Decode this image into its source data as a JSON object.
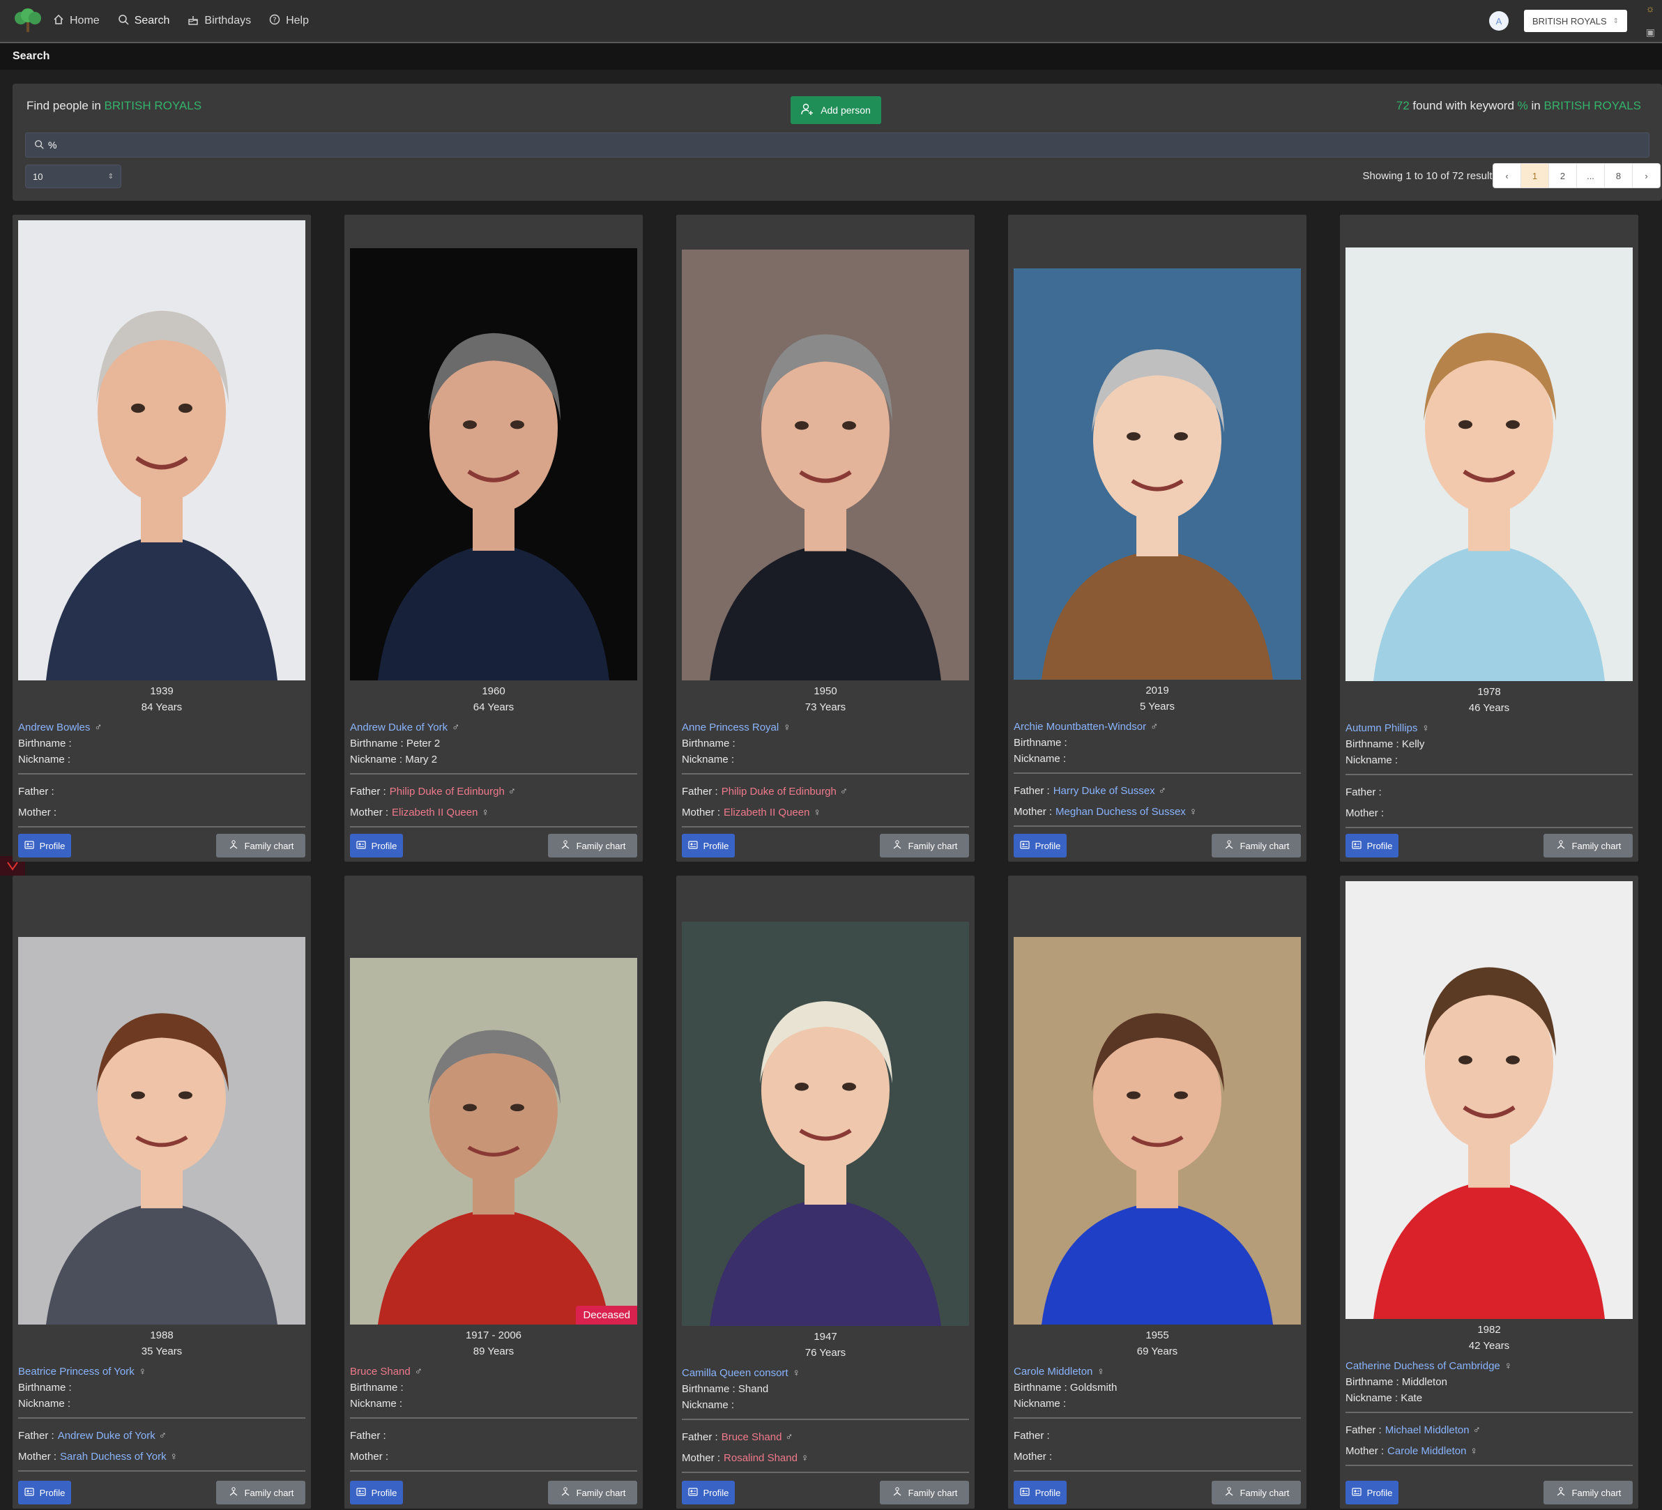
{
  "nav": {
    "items": [
      {
        "label": "Home",
        "icon": "home-icon"
      },
      {
        "label": "Search",
        "icon": "search-icon"
      },
      {
        "label": "Birthdays",
        "icon": "cake-icon"
      },
      {
        "label": "Help",
        "icon": "help-icon"
      }
    ],
    "avatar_initial": "A",
    "database_select": "BRITISH ROYALS"
  },
  "subheader": {
    "title": "Search"
  },
  "search_panel": {
    "find_prefix": "Find people in",
    "database_name": "BRITISH ROYALS",
    "add_person_label": "Add person",
    "found_count": "72",
    "found_text": "found with keyword",
    "keyword": "%",
    "found_in": "in",
    "found_db": "BRITISH ROYALS",
    "search_value": "%",
    "page_size": "10",
    "showing_text": "Showing 1 to 10 of 72 results",
    "pagination": [
      "1",
      "2",
      "...",
      "8"
    ]
  },
  "labels": {
    "birthname": "Birthname :",
    "nickname": "Nickname :",
    "father": "Father :",
    "mother": "Mother :",
    "profile": "Profile",
    "family_chart": "Family chart",
    "deceased": "Deceased"
  },
  "colors": {
    "accent_green": "#35b36b",
    "link_blue": "#8ab4ff",
    "link_red": "#f07a8c",
    "profile_button": "#3a63c6",
    "family_chart_button": "#6f737a",
    "deceased_badge": "#d9224d"
  },
  "people": [
    {
      "year": "1939",
      "age": "84 Years",
      "name": "Andrew Bowles",
      "name_color": "blue",
      "gender": "♂",
      "birthname": "",
      "nickname": "",
      "father": "",
      "father_color": "",
      "father_gender": "",
      "mother": "",
      "mother_color": "",
      "mother_gender": "",
      "deceased": false
    },
    {
      "year": "1960",
      "age": "64 Years",
      "name": "Andrew Duke of York",
      "name_color": "blue",
      "gender": "♂",
      "birthname": "Peter 2",
      "nickname": "Mary 2",
      "father": "Philip Duke of Edinburgh",
      "father_color": "red",
      "father_gender": "♂",
      "mother": "Elizabeth II Queen",
      "mother_color": "red",
      "mother_gender": "♀",
      "deceased": false
    },
    {
      "year": "1950",
      "age": "73 Years",
      "name": "Anne Princess Royal",
      "name_color": "blue",
      "gender": "♀",
      "birthname": "",
      "nickname": "",
      "father": "Philip Duke of Edinburgh",
      "father_color": "red",
      "father_gender": "♂",
      "mother": "Elizabeth II Queen",
      "mother_color": "red",
      "mother_gender": "♀",
      "deceased": false
    },
    {
      "year": "2019",
      "age": "5 Years",
      "name": "Archie Mountbatten-Windsor",
      "name_color": "blue",
      "gender": "♂",
      "birthname": "",
      "nickname": "",
      "father": "Harry Duke of Sussex",
      "father_color": "blue",
      "father_gender": "♂",
      "mother": "Meghan Duchess of Sussex",
      "mother_color": "blue",
      "mother_gender": "♀",
      "deceased": false
    },
    {
      "year": "1978",
      "age": "46 Years",
      "name": "Autumn Phillips",
      "name_color": "blue",
      "gender": "♀",
      "birthname": "Kelly",
      "nickname": "",
      "father": "",
      "father_color": "",
      "father_gender": "",
      "mother": "",
      "mother_color": "",
      "mother_gender": "",
      "deceased": false
    },
    {
      "year": "1988",
      "age": "35 Years",
      "name": "Beatrice Princess of York",
      "name_color": "blue",
      "gender": "♀",
      "birthname": "",
      "nickname": "",
      "father": "Andrew Duke of York",
      "father_color": "blue",
      "father_gender": "♂",
      "mother": "Sarah Duchess of York",
      "mother_color": "blue",
      "mother_gender": "♀",
      "deceased": false
    },
    {
      "year": "1917 - 2006",
      "age": "89 Years",
      "name": "Bruce Shand",
      "name_color": "red",
      "gender": "♂",
      "birthname": "",
      "nickname": "",
      "father": "",
      "father_color": "",
      "father_gender": "",
      "mother": "",
      "mother_color": "",
      "mother_gender": "",
      "deceased": true
    },
    {
      "year": "1947",
      "age": "76 Years",
      "name": "Camilla Queen consort",
      "name_color": "blue",
      "gender": "♀",
      "birthname": "Shand",
      "nickname": "",
      "father": "Bruce Shand",
      "father_color": "red",
      "father_gender": "♂",
      "mother": "Rosalind Shand",
      "mother_color": "red",
      "mother_gender": "♀",
      "deceased": false
    },
    {
      "year": "1955",
      "age": "69 Years",
      "name": "Carole Middleton",
      "name_color": "blue",
      "gender": "♀",
      "birthname": "Goldsmith",
      "nickname": "",
      "father": "",
      "father_color": "",
      "father_gender": "",
      "mother": "",
      "mother_color": "",
      "mother_gender": "",
      "deceased": false
    },
    {
      "year": "1982",
      "age": "42 Years",
      "name": "Catherine Duchess of Cambridge",
      "name_color": "blue",
      "gender": "♀",
      "birthname": "Middleton",
      "nickname": "Kate",
      "father": "Michael Middleton",
      "father_color": "blue",
      "father_gender": "♂",
      "mother": "Carole Middleton",
      "mother_color": "blue",
      "mother_gender": "♀",
      "deceased": false
    }
  ]
}
